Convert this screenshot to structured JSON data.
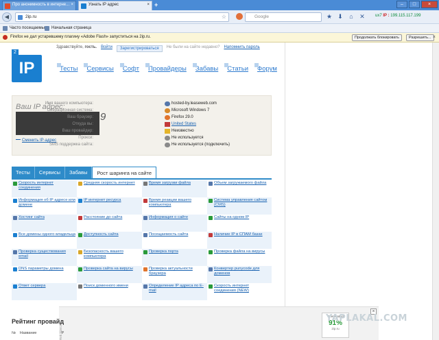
{
  "tabs": [
    {
      "label": "Про анонимность в интерне...",
      "active": false
    },
    {
      "label": "Узнать IP адрес",
      "active": true
    }
  ],
  "new_tab": "+",
  "url": "2ip.ru",
  "search_placeholder": "Google",
  "ip_status": {
    "prefix": "IP :",
    "value": "199.115.117.199",
    "left": "ux7"
  },
  "bookmarks": [
    "Часто посещаемые",
    "Начальная страница"
  ],
  "flash": {
    "message": "Firefox не дал устаревшему плагину «Adobe Flash» запуститься на 2ip.ru.",
    "btn_continue": "Продолжать блокировать",
    "btn_allow": "Разрешить...",
    "close": "×"
  },
  "login": {
    "greeting": "Здравствуйте,",
    "guest": "гость.",
    "login": "Войти",
    "register": "Зарегистрироваться",
    "forgot": "Не были на сайте недавно?",
    "remind": "Напомнить пароль"
  },
  "logo": {
    "text": "IP",
    "badge": "2"
  },
  "nav": [
    "Тесты",
    "Сервисы",
    "Софт",
    "Провайдеры",
    "Забавы",
    "Статьи",
    "Форум"
  ],
  "ipbox": {
    "heading": "Ваш IP адрес:",
    "partial": "9",
    "change": "Сменить IP-адрес",
    "rows": [
      {
        "label": "Имя вашего компьютера:",
        "value": "hosted-by.leaseweb.com",
        "color": "#5577aa"
      },
      {
        "label": "Операционная система:",
        "value": "Microsoft Windows 7",
        "color": "#d88a2a"
      },
      {
        "label": "Ваш браузер:",
        "value": "Firefox 29.0",
        "color": "#e0742c"
      },
      {
        "label": "Откуда вы:",
        "value": "United States",
        "color": "#c23a3a",
        "link": true
      },
      {
        "label": "Ваш провайдер:",
        "value": "Неизвестно",
        "color": "#e5b52a"
      },
      {
        "label": "Прокси:",
        "value": "Не используется",
        "color": "#8a8a8a"
      },
      {
        "label": "SMS поддержка сайта:",
        "value": "Не используется (подключить)",
        "color": "#8a8a8a"
      }
    ]
  },
  "tabs2": [
    "Тесты",
    "Сервисы",
    "Забавы",
    "Рост шаринга на сайте"
  ],
  "grid": [
    {
      "t": "Скорость интернет соединения",
      "c": "#2a9a3a"
    },
    {
      "t": "Средняя скорость интернет",
      "c": "#d8a72a"
    },
    {
      "t": "Время загрузки файла",
      "c": "#777"
    },
    {
      "t": "Объем загружаемого файла",
      "c": "#5577aa"
    },
    {
      "t": "Информация об IP адресе или домене",
      "c": "#1a7fd0"
    },
    {
      "t": "IP интернет ресурса",
      "c": "#1a7fd0"
    },
    {
      "t": "Время реакции вашего компьютера",
      "c": "#c23a3a"
    },
    {
      "t": "Система управления сайтом (CMS)",
      "c": "#2a9a3a"
    },
    {
      "t": "Хостинг сайта",
      "c": "#5577aa"
    },
    {
      "t": "Расстояние до сайта",
      "c": "#c23a3a"
    },
    {
      "t": "Информация о сайте",
      "c": "#5577aa"
    },
    {
      "t": "Сайты на одном IP",
      "c": "#2a9a3a"
    },
    {
      "t": "Все домены одного владельца",
      "c": "#1a7fd0"
    },
    {
      "t": "Доступность сайта",
      "c": "#2a9a3a"
    },
    {
      "t": "Посещаемость сайта",
      "c": "#5577aa"
    },
    {
      "t": "Наличие IP в СПАМ базах",
      "c": "#c23a3a"
    },
    {
      "t": "Проверка существования email",
      "c": "#5577aa"
    },
    {
      "t": "Безопасность вашего компьютера",
      "c": "#d8a72a"
    },
    {
      "t": "Проверка порта",
      "c": "#2a9a3a"
    },
    {
      "t": "Проверка файла на вирусы",
      "c": "#2a9a3a"
    },
    {
      "t": "DNS параметры домена",
      "c": "#1a7fd0"
    },
    {
      "t": "Проверка сайта на вирусы",
      "c": "#2a9a3a"
    },
    {
      "t": "Проверка актуальности браузера",
      "c": "#e0742c"
    },
    {
      "t": "Конвертер punycode для доменов",
      "c": "#5577aa"
    },
    {
      "t": "Ответ сервера",
      "c": "#1a7fd0"
    },
    {
      "t": "Поиск доменного имени",
      "c": "#777"
    },
    {
      "t": "Определение IP адреса по E-mail",
      "c": "#5577aa"
    },
    {
      "t": "Скорость интернет соединения (NEW)",
      "c": "#2a9a3a"
    }
  ],
  "rating": {
    "title": "Рейтинг провайд",
    "col1": "№",
    "col2": "Название",
    "col3": "Р"
  },
  "ad": {
    "side": "Rek Tizer.ru",
    "close": "×",
    "w_label": "Tizer Rating",
    "w_value": "91%",
    "w_domain": "2ip.ru"
  },
  "watermark": "YAPLAKAL.COM"
}
